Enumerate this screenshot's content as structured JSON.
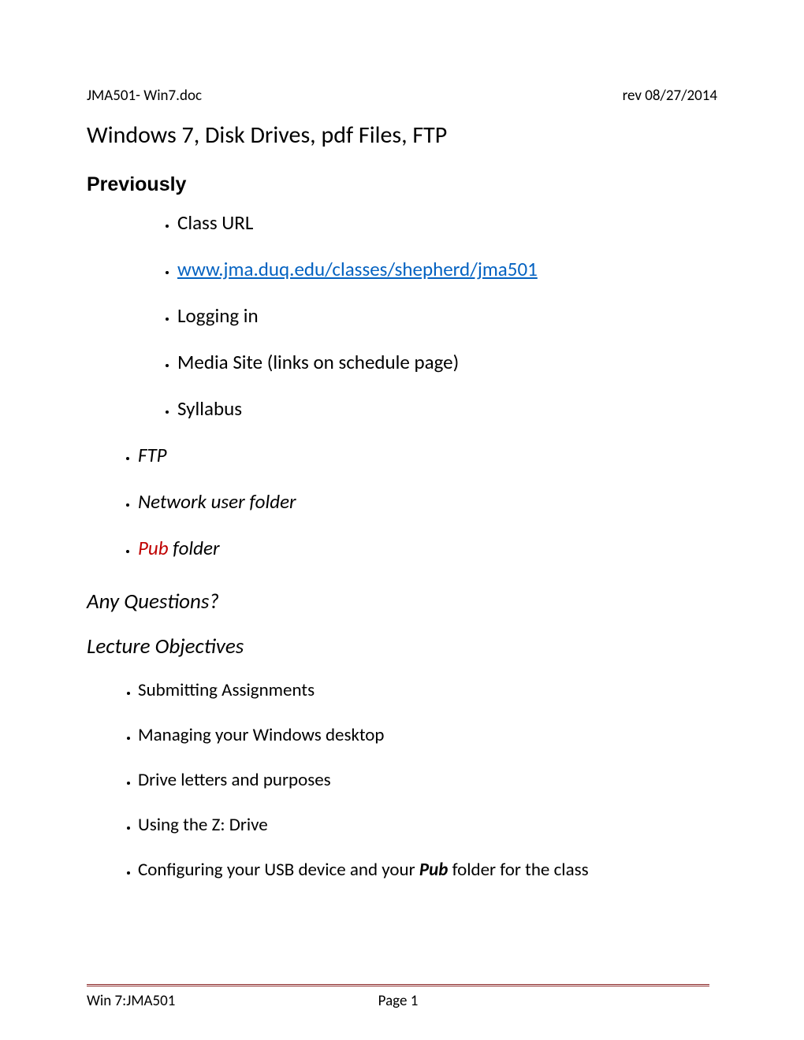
{
  "header": {
    "left": "JMA501- Win7.doc",
    "right": "rev 08/27/2014"
  },
  "title": "Windows 7, Disk Drives, pdf Files, FTP",
  "previously": {
    "heading": "Previously",
    "inner_items": [
      "Class URL",
      "www.jma.duq.edu/classes/shepherd/jma501",
      "Logging in",
      "Media Site (links on schedule page)",
      "Syllabus"
    ],
    "outer_items": [
      "FTP",
      "Network user folder"
    ],
    "pub": "Pub",
    "pub_suffix": " folder"
  },
  "questions": "Any Questions?",
  "objectives_heading": "Lecture Objectives",
  "objectives": [
    "Submitting Assignments",
    "Managing your Windows  desktop",
    "Drive letters and purposes",
    "Using the Z: Drive"
  ],
  "objective_usb_prefix": "Configuring your USB device and your ",
  "objective_usb_bold": "Pub",
  "objective_usb_suffix": " folder for the class",
  "footer": {
    "left": "Win 7:JMA501",
    "center": "Page 1"
  }
}
